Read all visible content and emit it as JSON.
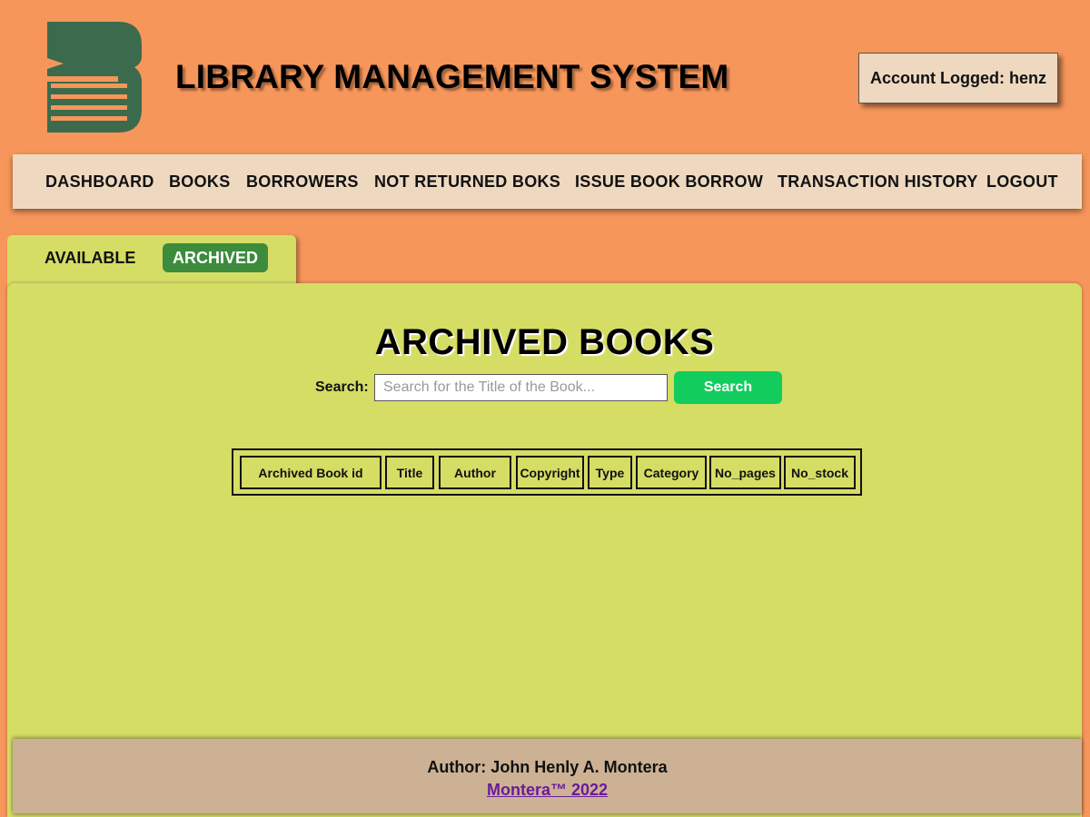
{
  "header": {
    "title": "LIBRARY MANAGEMENT SYSTEM",
    "account": "Account Logged: henz",
    "logo_icon": "book-logo-icon",
    "logo_color": "#3c6a4c"
  },
  "nav": {
    "items": [
      {
        "label": "DASHBOARD"
      },
      {
        "label": "BOOKS"
      },
      {
        "label": "BORROWERS"
      },
      {
        "label": "NOT RETURNED BOKS"
      },
      {
        "label": "ISSUE BOOK BORROW"
      },
      {
        "label": "TRANSACTION HISTORY"
      },
      {
        "label": "LOGOUT"
      }
    ]
  },
  "tabs": {
    "available": "AVAILABLE",
    "archived": "ARCHIVED",
    "active": "ARCHIVED"
  },
  "main": {
    "title": "ARCHIVED BOOKS",
    "search_label": "Search:",
    "search_placeholder": "Search for the Title of the Book...",
    "search_value": "",
    "search_button": "Search"
  },
  "table": {
    "columns": [
      "Archived Book id",
      "Title",
      "Author",
      "Copyright",
      "Type",
      "Category",
      "No_pages",
      "No_stock"
    ],
    "rows": []
  },
  "footer": {
    "author": "Author: John Henly A. Montera",
    "link": "Montera™ 2022"
  },
  "colors": {
    "background": "#f7965a",
    "panel": "#d5dd65",
    "nav": "#eed9c0",
    "active_tab": "#3d8b3d",
    "search_button": "#12cc5e",
    "footer": "#cdb194",
    "link": "#6a1b9a"
  }
}
